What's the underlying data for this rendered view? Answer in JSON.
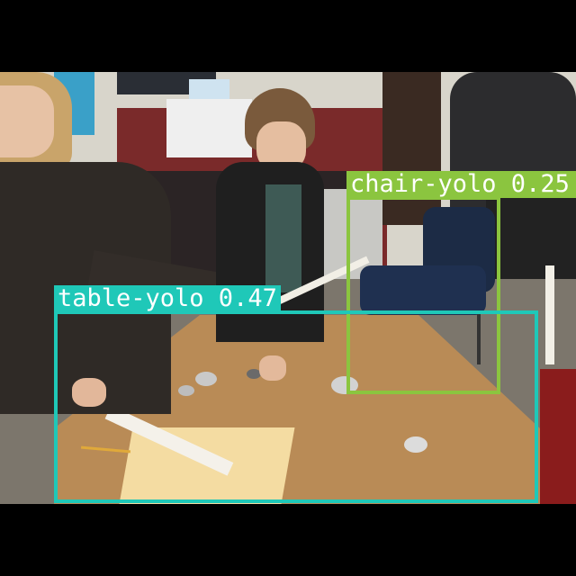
{
  "image": {
    "description_free": true
  },
  "detections": [
    {
      "label": "chair-yolo",
      "score": "0.25",
      "color": "#8bc53f"
    },
    {
      "label": "table-yolo",
      "score": "0.47",
      "color": "#1fc8b8"
    }
  ],
  "colors": {
    "letterbox": "#000000",
    "wall": "#d9d6cc",
    "floor": "#7d776d",
    "table": "#b88a55",
    "paper": "#f3dca0"
  }
}
